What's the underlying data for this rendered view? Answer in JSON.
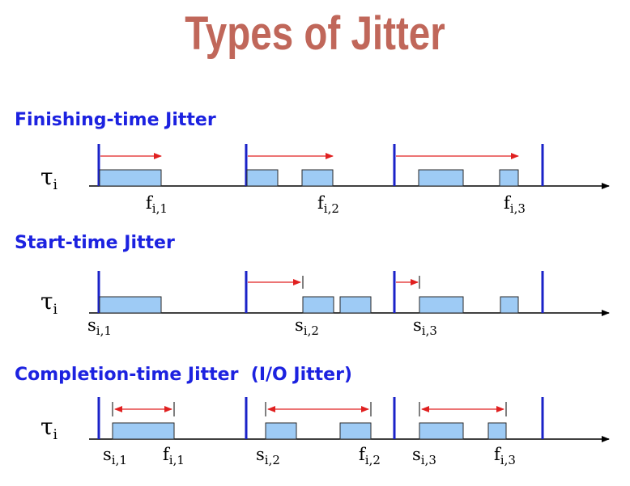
{
  "title": "Types of Jitter",
  "sections": [
    {
      "heading": "Finishing-time Jitter",
      "task_symbol": "τ",
      "task_subscript": "i",
      "labels": [
        {
          "base": "f",
          "sub": "i,1"
        },
        {
          "base": "f",
          "sub": "i,2"
        },
        {
          "base": "f",
          "sub": "i,3"
        }
      ]
    },
    {
      "heading": "Start-time Jitter",
      "task_symbol": "τ",
      "task_subscript": "i",
      "labels": [
        {
          "base": "s",
          "sub": "i,1"
        },
        {
          "base": "s",
          "sub": "i,2"
        },
        {
          "base": "s",
          "sub": "i,3"
        }
      ]
    },
    {
      "heading": "Completion-time Jitter  (I/O Jitter)",
      "task_symbol": "τ",
      "task_subscript": "i",
      "labels": [
        {
          "base": "s",
          "sub": "i,1"
        },
        {
          "base": "f",
          "sub": "i,1"
        },
        {
          "base": "s",
          "sub": "i,2"
        },
        {
          "base": "f",
          "sub": "i,2"
        },
        {
          "base": "s",
          "sub": "i,3"
        },
        {
          "base": "f",
          "sub": "i,3"
        }
      ]
    }
  ],
  "colors": {
    "title": "#c0675a",
    "heading": "#1c22e0",
    "period_line": "#1a22c8",
    "job_fill": "#9ecbf5",
    "job_stroke": "#2a2a2a",
    "jitter_arrow": "#e02020",
    "axis": "#000000"
  }
}
